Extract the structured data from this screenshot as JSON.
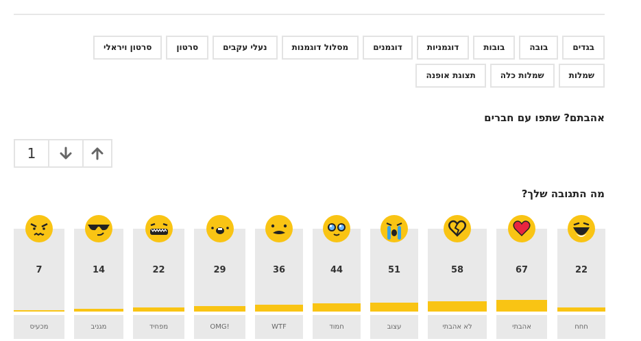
{
  "tags": [
    "בגדים",
    "בובה",
    "בובות",
    "דוגמניות",
    "דוגמנים",
    "מסלול דוגמנות",
    "נעלי עקבים",
    "סרטון",
    "סרטון ויראלי",
    "שמלות",
    "שמלות כלה",
    "תצוגת אופנה"
  ],
  "share": {
    "title": "אהבתם? שתפו עם חברים"
  },
  "vote": {
    "count": "1",
    "up_icon": "arrow-up-icon",
    "down_icon": "arrow-down-icon"
  },
  "reactions_title": "מה התגובה שלך?",
  "reactions": [
    {
      "label": "חחח",
      "count": "22",
      "icon": "laughing-face-icon",
      "fill_pct": 5
    },
    {
      "label": "אהבתי",
      "count": "67",
      "icon": "heart-icon",
      "fill_pct": 14
    },
    {
      "label": "לא אהבתי",
      "count": "58",
      "icon": "broken-heart-icon",
      "fill_pct": 12
    },
    {
      "label": "עצוב",
      "count": "51",
      "icon": "crying-face-icon",
      "fill_pct": 11
    },
    {
      "label": "חמוד",
      "count": "44",
      "icon": "cute-face-icon",
      "fill_pct": 10
    },
    {
      "label": "WTF",
      "count": "36",
      "icon": "wtf-face-icon",
      "fill_pct": 8
    },
    {
      "label": "OMG!",
      "count": "29",
      "icon": "omg-face-icon",
      "fill_pct": 7
    },
    {
      "label": "מפחיד",
      "count": "22",
      "icon": "scared-face-icon",
      "fill_pct": 5
    },
    {
      "label": "מגניב",
      "count": "14",
      "icon": "cool-face-icon",
      "fill_pct": 3
    },
    {
      "label": "מכעיס",
      "count": "7",
      "icon": "angry-face-icon",
      "fill_pct": 2
    }
  ],
  "colors": {
    "accent": "#f9c414",
    "panel": "#e9e9e9",
    "border": "#e3e3e3"
  }
}
